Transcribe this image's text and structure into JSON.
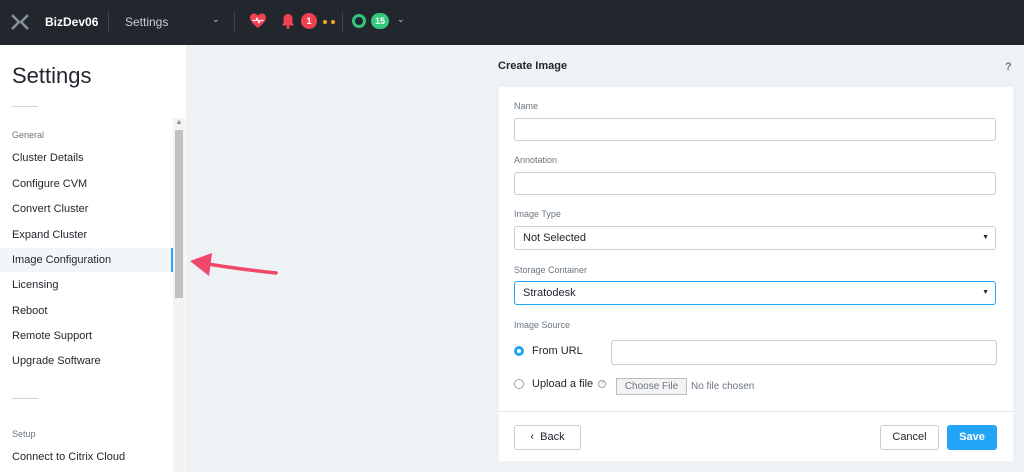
{
  "topbar": {
    "cluster_name": "BizDev06",
    "page_menu": "Settings",
    "alert_count": "1",
    "task_count": "15"
  },
  "sidebar": {
    "title": "Settings",
    "groups": [
      {
        "label": "General",
        "items": [
          {
            "label": "Cluster Details"
          },
          {
            "label": "Configure CVM"
          },
          {
            "label": "Convert Cluster"
          },
          {
            "label": "Expand Cluster"
          },
          {
            "label": "Image Configuration",
            "active": true
          },
          {
            "label": "Licensing"
          },
          {
            "label": "Reboot"
          },
          {
            "label": "Remote Support"
          },
          {
            "label": "Upgrade Software"
          }
        ]
      },
      {
        "label": "Setup",
        "items": [
          {
            "label": "Connect to Citrix Cloud"
          }
        ]
      }
    ]
  },
  "dialog": {
    "title": "Create Image",
    "help": "?",
    "name": {
      "label": "Name",
      "value": ""
    },
    "annotation": {
      "label": "Annotation",
      "value": ""
    },
    "image_type": {
      "label": "Image Type",
      "selected": "Not Selected"
    },
    "storage_container": {
      "label": "Storage Container",
      "selected": "Stratodesk"
    },
    "image_source": {
      "label": "Image Source",
      "from_url": "From URL",
      "upload_file": "Upload a file",
      "choose_file": "Choose File",
      "no_file": "No file chosen",
      "selected_option": "From URL",
      "url_value": ""
    },
    "buttons": {
      "back": "Back",
      "cancel": "Cancel",
      "save": "Save"
    }
  },
  "colors": {
    "topbar_bg": "#22272e",
    "accent": "#22a5f7",
    "alert": "#f0414e",
    "success": "#34c77b",
    "annotation_arrow": "#f0476a"
  }
}
